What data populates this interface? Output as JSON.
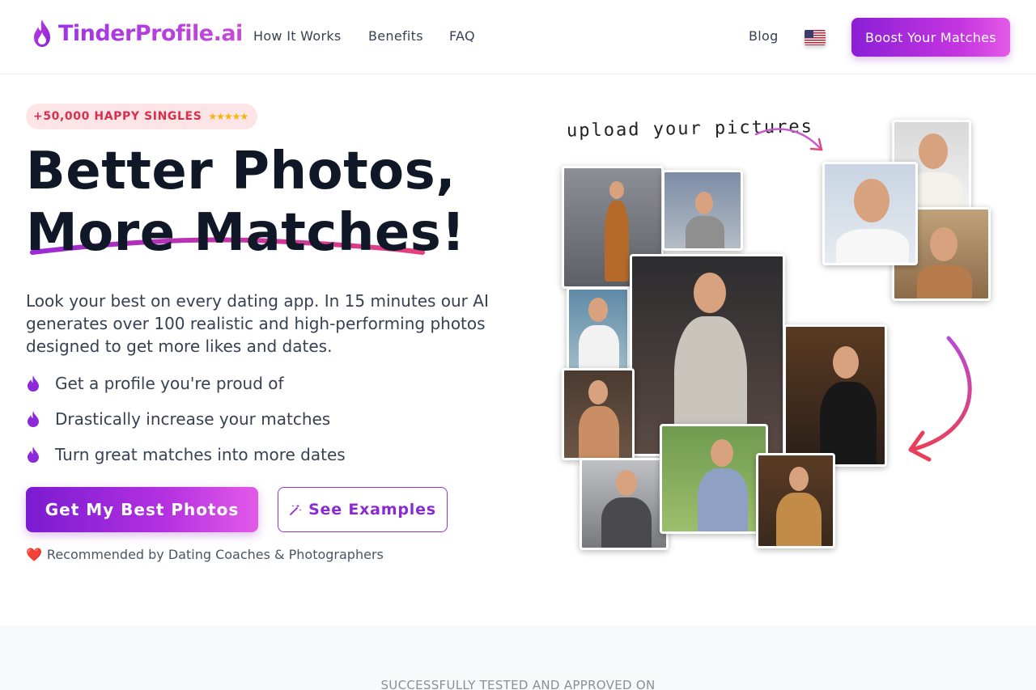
{
  "header": {
    "logo_text": "TinderProfile.ai",
    "nav": [
      "How It Works",
      "Benefits",
      "FAQ"
    ],
    "blog": "Blog",
    "flag_icon": "us-flag-icon",
    "cta": "Boost Your Matches"
  },
  "hero": {
    "badge": "+50,000 HAPPY SINGLES",
    "badge_stars": "★★★★★",
    "headline_line1": "Better Photos,",
    "headline_line2": "More Matches!",
    "lead": "Look your best on every dating app. In 15 minutes our AI generates over 100 realistic and high-performing photos designed to get more likes and dates.",
    "features": [
      "Get a profile you're proud of",
      "Drastically increase your matches",
      "Turn great matches into more dates"
    ],
    "primary_cta": "Get My Best Photos",
    "secondary_cta": "See Examples",
    "recommended": "Recommended by Dating Coaches & Photographers",
    "recommended_icon": "❤️"
  },
  "collage": {
    "upload_label": "upload your pictures"
  },
  "footer_band": {
    "tested": "SUCCESSFULLY TESTED AND APPROVED ON"
  },
  "colors": {
    "brand_purple": "#8b1fd6",
    "brand_pink": "#e45be6",
    "badge_bg": "#fde4e6",
    "badge_text": "#d6304f",
    "arrow_pink": "#e84a8a"
  }
}
